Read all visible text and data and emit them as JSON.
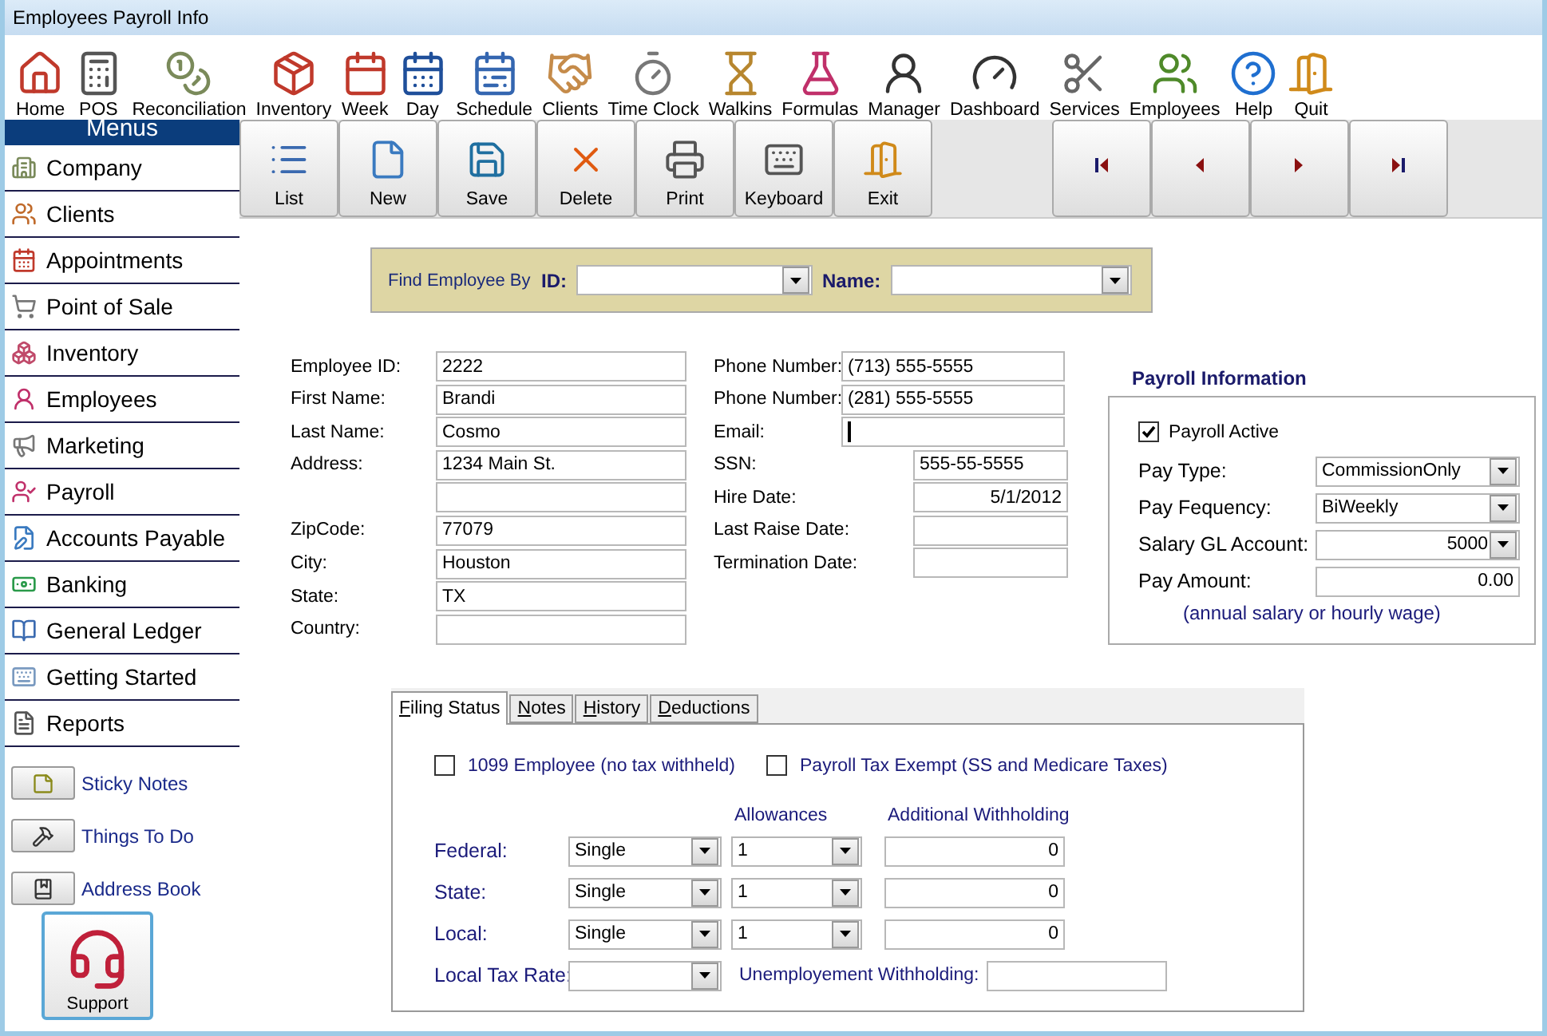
{
  "window": {
    "title": "Employees Payroll Info"
  },
  "toolbar": [
    "Home",
    "POS",
    "Reconciliation",
    "Inventory",
    "Week",
    "Day",
    "Schedule",
    "Clients",
    "Time Clock",
    "Walkins",
    "Formulas",
    "Manager",
    "Dashboard",
    "Services",
    "Employees",
    "Help",
    "Quit"
  ],
  "sidebar": {
    "header": "Menus",
    "items": [
      "Company",
      "Clients",
      "Appointments",
      "Point of Sale",
      "Inventory",
      "Employees",
      "Marketing",
      "Payroll",
      "Accounts Payable",
      "Banking",
      "General Ledger",
      "Getting Started",
      "Reports"
    ],
    "shortcuts": [
      "Sticky Notes",
      "Things To Do",
      "Address Book"
    ],
    "support": "Support"
  },
  "actions": [
    "List",
    "New",
    "Save",
    "Delete",
    "Print",
    "Keyboard",
    "Exit"
  ],
  "find": {
    "label": "Find Employee By",
    "id_label": "ID:",
    "name_label": "Name:"
  },
  "employee": {
    "left": [
      {
        "kind": "text",
        "label": "Employee  ID:",
        "value": "2222"
      },
      {
        "kind": "text",
        "label": "First Name:",
        "value": "Brandi"
      },
      {
        "kind": "text",
        "label": "Last Name:",
        "value": "Cosmo"
      },
      {
        "kind": "text",
        "label": "Address:",
        "value": "1234 Main St."
      },
      {
        "kind": "continuation"
      },
      {
        "kind": "text",
        "label": "ZipCode:",
        "value": "77079"
      },
      {
        "kind": "text",
        "label": "City:",
        "value": "Houston"
      },
      {
        "kind": "text",
        "label": "State:",
        "value": "TX"
      },
      {
        "kind": "text",
        "label": "Country:"
      }
    ],
    "right": [
      {
        "kind": "wide",
        "label": "Phone Number:",
        "value": "(713) 555-5555"
      },
      {
        "kind": "wide",
        "label": "Phone Number:",
        "value": "(281) 555-5555"
      },
      {
        "kind": "wide",
        "label": "Email:",
        "focused": true
      },
      {
        "kind": "narrow",
        "label": "SSN:",
        "value": "555-55-5555"
      },
      {
        "kind": "date",
        "label": "Hire Date:",
        "value": "5/1/2012"
      },
      {
        "kind": "date",
        "label": "Last Raise Date:"
      },
      {
        "kind": "date",
        "label": "Termination Date:"
      }
    ]
  },
  "payroll": {
    "title": "Payroll Information",
    "active": {
      "label": "Payroll Active",
      "checked": true
    },
    "rows": [
      {
        "kind": "dropdown",
        "label": "Pay Type:",
        "value": "CommissionOnly"
      },
      {
        "kind": "dropdown",
        "label": "Pay Fequency:",
        "value": "BiWeekly"
      },
      {
        "kind": "number_dropdown",
        "label": "Salary GL Account:",
        "value": "5000"
      },
      {
        "kind": "number",
        "label": "Pay Amount:",
        "value": "0.00"
      }
    ],
    "note": "(annual salary or hourly wage)"
  },
  "tabs": [
    {
      "label": "Filing Status",
      "selected": true
    },
    {
      "label": "Notes",
      "selected": false
    },
    {
      "label": "History",
      "selected": false
    },
    {
      "label": "Deductions",
      "selected": false
    }
  ],
  "filing": {
    "checkboxes": [
      {
        "label": "1099 Employee (no tax withheld)",
        "checked": false
      },
      {
        "label": "Payroll Tax Exempt  (SS and Medicare Taxes)",
        "checked": false
      }
    ],
    "headers": [
      "Allowances",
      "Additional Withholding"
    ],
    "rows": [
      {
        "label": "Federal:",
        "status": "Single",
        "allowances": "1",
        "additional": "0"
      },
      {
        "label": "State:",
        "status": "Single",
        "allowances": "1",
        "additional": "0"
      },
      {
        "label": "Local:",
        "status": "Single",
        "allowances": "1",
        "additional": "0"
      }
    ],
    "local_tax_rate": {
      "label": "Local Tax Rate:"
    },
    "unemployment": {
      "label": "Unemployement Withholding:"
    }
  }
}
